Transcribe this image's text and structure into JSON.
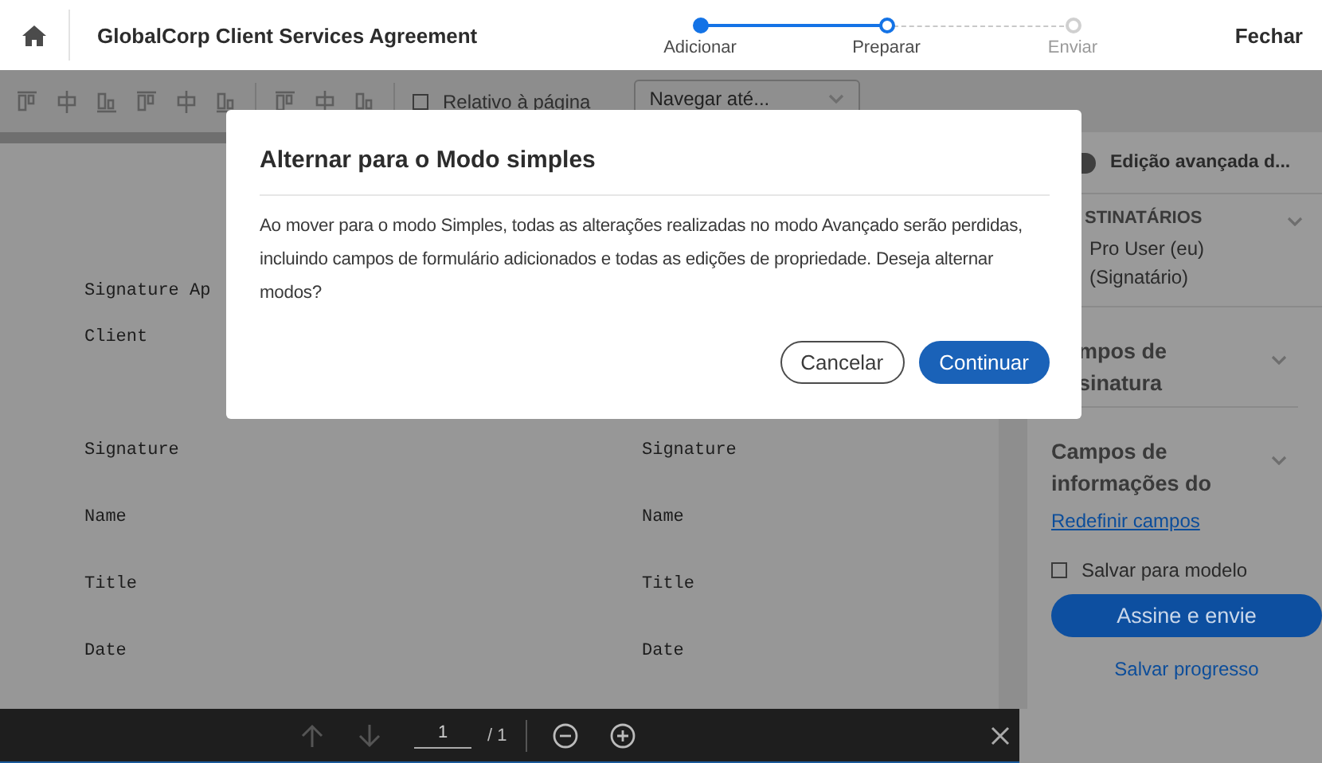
{
  "header": {
    "title": "GlobalCorp Client Services Agreement",
    "close": "Fechar"
  },
  "steps": [
    {
      "label": "Adicionar",
      "completed": true,
      "selected": false
    },
    {
      "label": "Preparar",
      "completed": false,
      "selected": true
    },
    {
      "label": "Enviar",
      "completed": false,
      "selected": false
    }
  ],
  "toolbar": {
    "relative_to_page": {
      "label": "Relativo à página",
      "checked": false
    },
    "navigate": {
      "value": "Navegar até..."
    }
  },
  "document": {
    "rows": [
      {
        "left": "Signature Ap"
      },
      {
        "left": "Client"
      },
      {
        "left": "Signature",
        "right": "Signature"
      },
      {
        "left": "Name",
        "right": "Name"
      },
      {
        "left": "Title",
        "right": "Title"
      },
      {
        "left": "Date",
        "right": "Date"
      }
    ]
  },
  "pager": {
    "page": "1",
    "total": "/ 1"
  },
  "sidebar": {
    "advanced": "Edição avançada d...",
    "advanced_on": true,
    "recipients_heading": "STINATÁRIOS",
    "recipient": [
      "Pro User (eu)",
      "(Signatário)"
    ],
    "sections": [
      {
        "lines": [
          "mpos de",
          "sinatura"
        ]
      },
      {
        "lines": [
          "Campos de",
          "informações do"
        ]
      }
    ],
    "reset_link": "Redefinir campos",
    "save_template": {
      "label": "Salvar para modelo",
      "checked": false
    },
    "primary": "Assine e envie",
    "save_progress": "Salvar progresso"
  },
  "dialog": {
    "title": "Alternar para o Modo simples",
    "message": "Ao mover para o modo Simples, todas as alterações realizadas no modo Avançado serão perdidas, incluindo campos de formulário adicionados e todas as edições de propriedade. Deseja alternar modos?",
    "buttons": [
      {
        "label": "Cancelar",
        "kind": "secondary"
      },
      {
        "label": "Continuar",
        "kind": "primary"
      }
    ]
  }
}
